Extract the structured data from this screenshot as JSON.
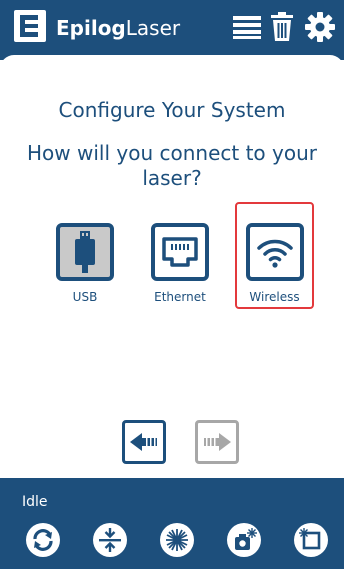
{
  "header": {
    "brand_bold": "Epilog",
    "brand_light": "Laser",
    "icons": [
      "list-icon",
      "trash-icon",
      "gear-icon"
    ]
  },
  "main": {
    "title": "Configure Your System",
    "question": "How will you connect to your laser?",
    "options": [
      {
        "label": "USB",
        "icon": "usb-icon",
        "selected": false
      },
      {
        "label": "Ethernet",
        "icon": "ethernet-icon",
        "selected": false
      },
      {
        "label": "Wireless",
        "icon": "wifi-icon",
        "selected": true
      }
    ]
  },
  "nav": {
    "back_icon": "arrow-left-icon",
    "next_icon": "arrow-right-icon",
    "next_enabled": false
  },
  "footer": {
    "status": "Idle",
    "buttons": [
      "refresh-icon",
      "focus-icon",
      "laser-icon",
      "camera-icon",
      "frame-icon"
    ]
  },
  "colors": {
    "brand": "#1d4f7c",
    "selected_border": "#e3393c",
    "disabled": "#a7a7a7"
  }
}
